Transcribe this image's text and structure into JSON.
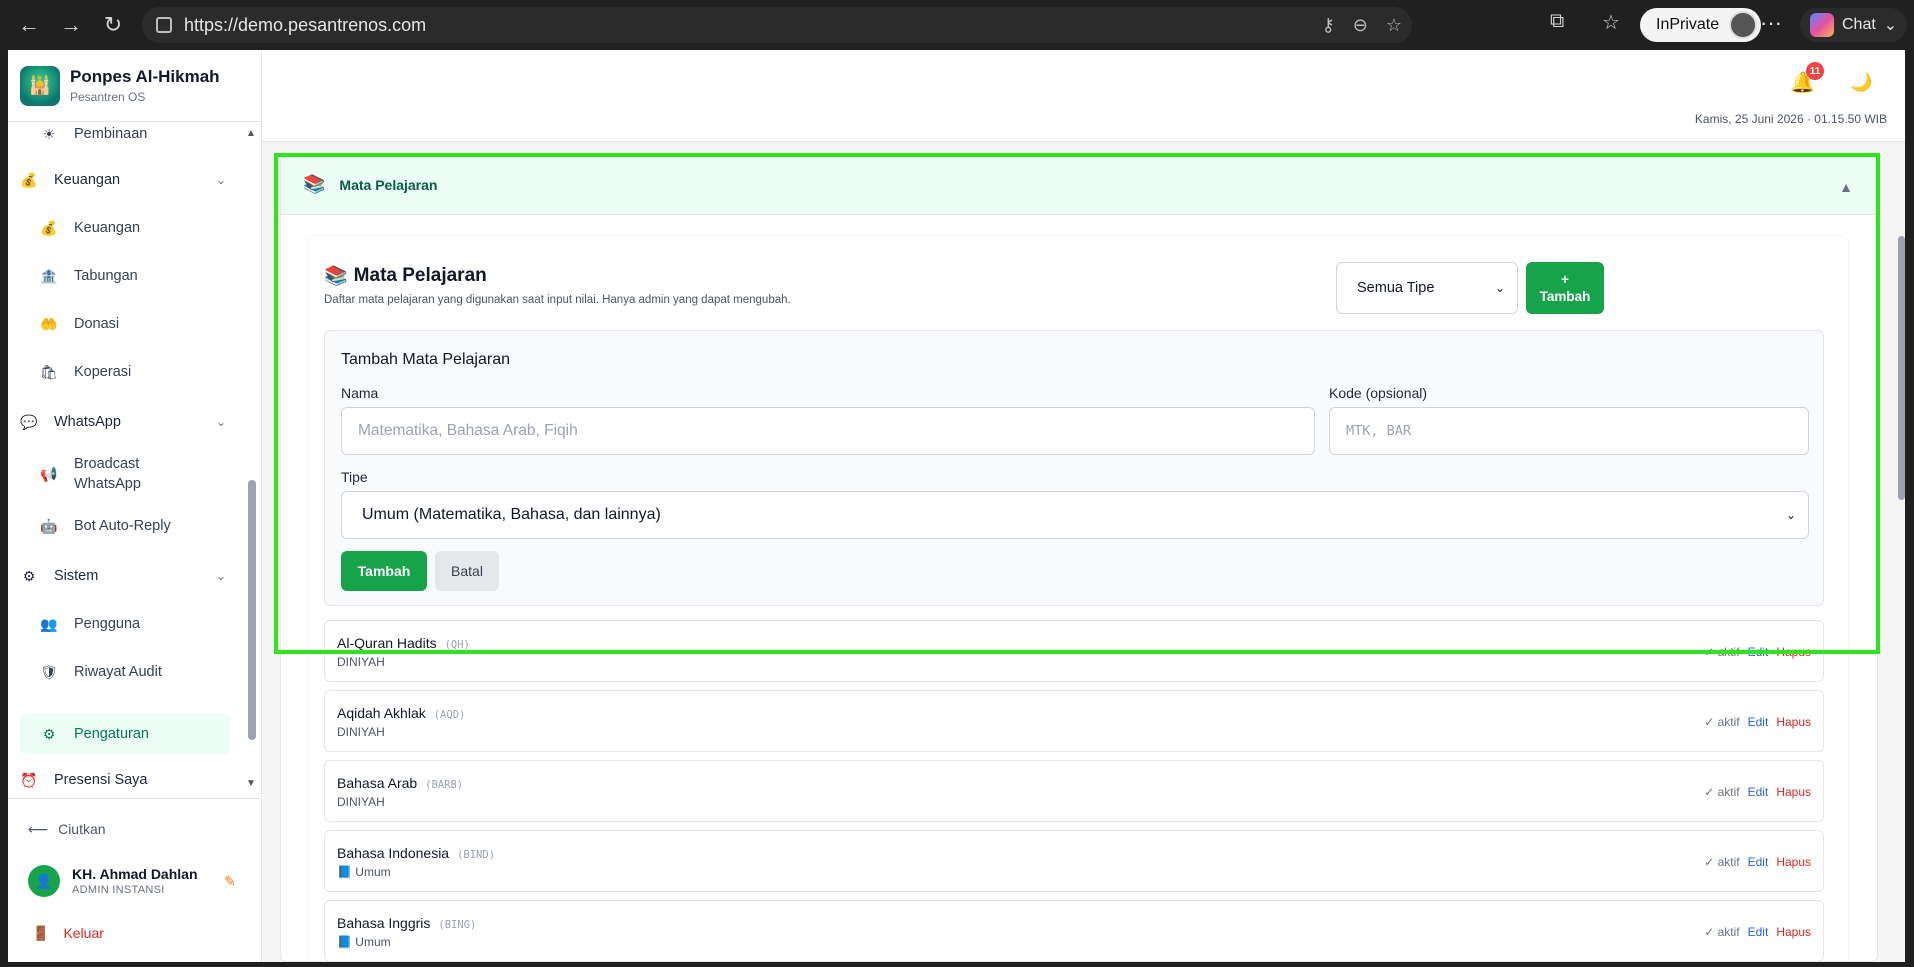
{
  "browser": {
    "url": "https://demo.pesantrenos.com",
    "inprivate_label": "InPrivate",
    "chat_label": "Chat",
    "more_label": "···"
  },
  "brand": {
    "name": "Ponpes Al-Hikmah",
    "subtitle": "Pesantren OS"
  },
  "sidebar": {
    "items": [
      {
        "label": "Pembinaan",
        "icon": "☀",
        "sub": true
      },
      {
        "label": "Keuangan",
        "icon": "💰",
        "group": true
      },
      {
        "label": "Keuangan",
        "icon": "💰",
        "sub": true
      },
      {
        "label": "Tabungan",
        "icon": "🏦",
        "sub": true
      },
      {
        "label": "Donasi",
        "icon": "🤲",
        "sub": true
      },
      {
        "label": "Koperasi",
        "icon": "🛍",
        "sub": true
      },
      {
        "label": "WhatsApp",
        "icon": "💬",
        "group": true
      },
      {
        "label": "Broadcast",
        "label2": "WhatsApp",
        "icon": "📢",
        "sub": true
      },
      {
        "label": "Bot Auto-Reply",
        "icon": "🤖",
        "sub": true
      },
      {
        "label": "Sistem",
        "icon": "⚙",
        "group": true
      },
      {
        "label": "Pengguna",
        "icon": "👥",
        "sub": true
      },
      {
        "label": "Riwayat Audit",
        "icon": "🛡",
        "sub": true
      },
      {
        "label": "Pengaturan",
        "icon": "⚙",
        "sub": true,
        "active": true
      },
      {
        "label": "Presensi Saya",
        "icon": "⏰",
        "group": false
      }
    ],
    "collapse_label": "Ciutkan",
    "user_name": "KH. Ahmad Dahlan",
    "user_role": "ADMIN INSTANSI",
    "logout_label": "Keluar"
  },
  "topbar": {
    "notification_count": "11",
    "datetime": "Kamis, 25 Juni 2026 · 01.15.50 WIB"
  },
  "panel": {
    "title": "Mata Pelajaran"
  },
  "card": {
    "title": "Mata Pelajaran",
    "description": "Daftar mata pelajaran yang digunakan saat input nilai. Hanya admin yang dapat mengubah.",
    "filter_value": "Semua Tipe",
    "add_icon": "+",
    "add_label": "Tambah"
  },
  "form": {
    "title": "Tambah Mata Pelajaran",
    "name_label": "Nama",
    "name_placeholder": "Matematika, Bahasa Arab, Fiqih",
    "code_label": "Kode (opsional)",
    "code_placeholder": "MTK, BAR",
    "type_label": "Tipe",
    "type_value": "Umum (Matematika, Bahasa, dan lainnya)",
    "submit_label": "Tambah",
    "cancel_label": "Batal"
  },
  "subjects": [
    {
      "name": "Al-Quran Hadits",
      "code": "(QH)",
      "type": "DINIYAH",
      "status": "✓ aktif",
      "edit": "Edit",
      "delete": "Hapus"
    },
    {
      "name": "Aqidah Akhlak",
      "code": "(AQD)",
      "type": "DINIYAH",
      "status": "✓ aktif",
      "edit": "Edit",
      "delete": "Hapus"
    },
    {
      "name": "Bahasa Arab",
      "code": "(BARB)",
      "type": "DINIYAH",
      "status": "✓ aktif",
      "edit": "Edit",
      "delete": "Hapus"
    },
    {
      "name": "Bahasa Indonesia",
      "code": "(BIND)",
      "type": "📘 Umum",
      "status": "✓ aktif",
      "edit": "Edit",
      "delete": "Hapus"
    },
    {
      "name": "Bahasa Inggris",
      "code": "(BING)",
      "type": "📘 Umum",
      "status": "✓ aktif",
      "edit": "Edit",
      "delete": "Hapus"
    }
  ],
  "colors": {
    "accent": "#16a34a",
    "highlight": "#2ee51c",
    "danger": "#dc2626",
    "link": "#2563eb"
  }
}
